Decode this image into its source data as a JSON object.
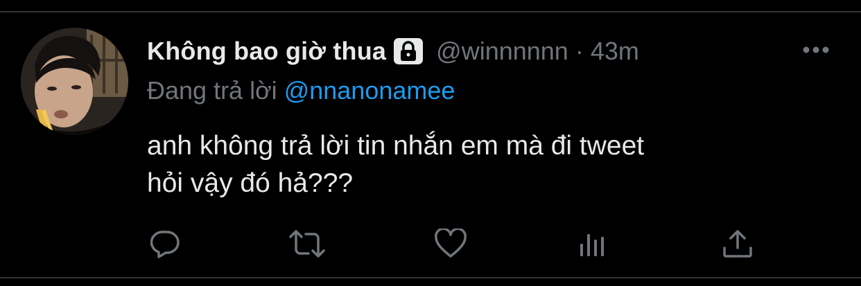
{
  "tweet": {
    "display_name": "Không bao giờ thua",
    "handle": "@winnnnnn",
    "separator": "·",
    "time": "43m",
    "reply_prefix": "Đang trả lời",
    "reply_to": "@nnanonamee",
    "text_line1": "anh không trả lời tin nhắn em mà đi tweet",
    "text_line2": "hỏi vậy đó hả???"
  },
  "icons": {
    "lock": "lock-icon",
    "more": "more-icon",
    "reply": "reply-icon",
    "retweet": "retweet-icon",
    "like": "like-icon",
    "views": "views-icon",
    "share": "share-icon"
  },
  "colors": {
    "background": "#000000",
    "primary_text": "#e7e9ea",
    "secondary_text": "#71767b",
    "link": "#1d9bf0",
    "divider": "#2f3336"
  }
}
